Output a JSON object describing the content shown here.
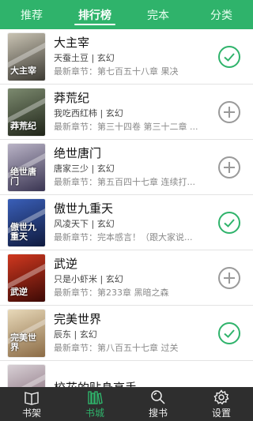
{
  "top_tabs": [
    {
      "label": "推荐",
      "active": false
    },
    {
      "label": "排行榜",
      "active": true
    },
    {
      "label": "完本",
      "active": false
    },
    {
      "label": "分类",
      "active": false
    }
  ],
  "books": [
    {
      "title": "大主宰",
      "author": "天蚕土豆",
      "genre": "玄幻",
      "latest": "最新章节：第七百五十八章 果决",
      "status": "added",
      "cover_text": "大主宰",
      "cover_colors": [
        "#c9c3b3",
        "#3c3a33"
      ]
    },
    {
      "title": "莽荒纪",
      "author": "我吃西红柿",
      "genre": "玄幻",
      "latest": "最新章节：第三十四卷 第三十二章 ...",
      "status": "add",
      "cover_text": "莽荒纪",
      "cover_colors": [
        "#7c8a6f",
        "#1f2418"
      ]
    },
    {
      "title": "绝世唐门",
      "author": "唐家三少",
      "genre": "玄幻",
      "latest": "最新章节：第五百四十七章 连续打...",
      "status": "add",
      "cover_text": "绝世唐门",
      "cover_colors": [
        "#b9b3c6",
        "#3a3552"
      ]
    },
    {
      "title": "傲世九重天",
      "author": "风凌天下",
      "genre": "玄幻",
      "latest": "最新章节：完本感言！（跟大家说...",
      "status": "added",
      "cover_text": "傲世九重天",
      "cover_colors": [
        "#3a5fb8",
        "#0f1a3e"
      ]
    },
    {
      "title": "武逆",
      "author": "只是小虾米",
      "genre": "玄幻",
      "latest": "最新章节：第233章 黑暗之森",
      "status": "add",
      "cover_text": "武逆",
      "cover_colors": [
        "#d0381f",
        "#3d0a06"
      ]
    },
    {
      "title": "完美世界",
      "author": "辰东",
      "genre": "玄幻",
      "latest": "最新章节：第八百五十七章 过关",
      "status": "added",
      "cover_text": "完美世界",
      "cover_colors": [
        "#e8d9b9",
        "#8b6b45"
      ]
    },
    {
      "title": "校花的贴身高手",
      "author": "",
      "genre": "",
      "latest": "",
      "status": "",
      "cover_text": "",
      "cover_colors": [
        "#d8d0d5",
        "#7a5f6e"
      ]
    }
  ],
  "bottom_nav": [
    {
      "label": "书架",
      "icon": "book-icon",
      "active": false
    },
    {
      "label": "书城",
      "icon": "store-icon",
      "active": true
    },
    {
      "label": "搜书",
      "icon": "search-icon",
      "active": false
    },
    {
      "label": "设置",
      "icon": "gear-icon",
      "active": false
    }
  ],
  "colors": {
    "accent": "#2fb36b",
    "bottom_bg": "#2e2e2e",
    "add_gray": "#9a9a9a"
  }
}
